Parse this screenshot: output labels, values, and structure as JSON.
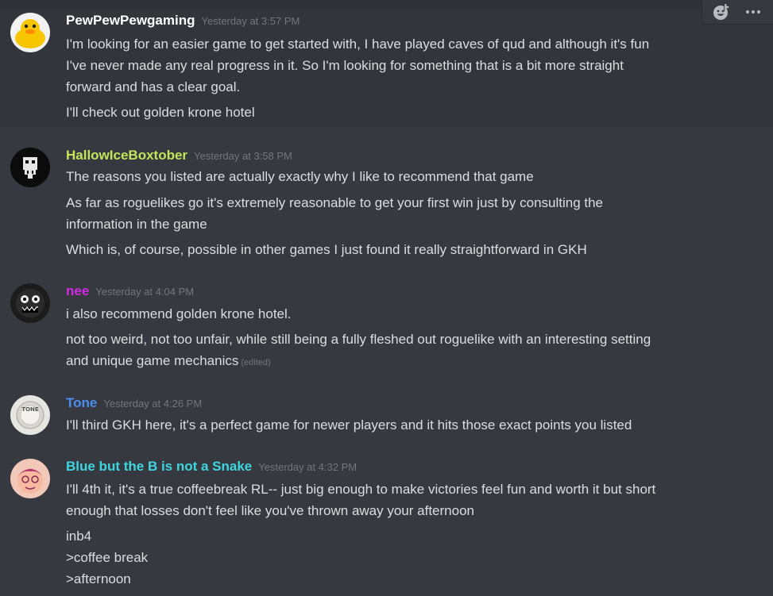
{
  "colors": {
    "background": "#36393f",
    "text": "#dcddde",
    "timestamp": "#72767d",
    "user_pewpew": "#ffffff",
    "user_hallow": "#c6e35a",
    "user_nee": "#d12be3",
    "user_tone": "#4b8df0",
    "user_blue": "#3fd6e0"
  },
  "toolbar": {
    "add_reaction_icon": "add-reaction-icon",
    "more_icon": "more-icon"
  },
  "messages": [
    {
      "username": "PewPewPewgaming",
      "timestamp": "Yesterday at 3:57 PM",
      "lines": [
        "I'm looking for an easier game to get started with, I have played caves of qud and although it's fun",
        "I've never made any real progress in it. So I'm looking for something that is a bit more straight",
        "forward and has a clear goal.",
        "I'll check out golden krone hotel"
      ]
    },
    {
      "username": "HallowIceBoxtober",
      "timestamp": "Yesterday at 3:58 PM",
      "lines": [
        "The reasons you listed are actually exactly why I like to recommend that game",
        "As far as roguelikes go it's extremely reasonable to get your first win just by consulting the",
        "information in the game",
        "Which is, of course, possible in other games I just found it really straightforward in GKH"
      ]
    },
    {
      "username": "nee",
      "timestamp": "Yesterday at 4:04 PM",
      "lines": [
        "i also recommend golden krone hotel.",
        "not too weird, not too unfair, while still being a fully fleshed out roguelike with an interesting setting",
        "and unique game mechanics"
      ],
      "edited": "(edited)"
    },
    {
      "username": "Tone",
      "timestamp": "Yesterday at 4:26 PM",
      "avatar_text": "TONE",
      "lines": [
        "I'll third GKH here, it's a perfect game for newer players and it hits those exact points you listed"
      ]
    },
    {
      "username": "Blue but the B is not a Snake",
      "timestamp": "Yesterday at 4:32 PM",
      "lines": [
        "I'll 4th it, it's a true coffeebreak RL-- just big enough to make victories feel fun and worth it but short",
        "enough that losses don't feel like you've thrown away your afternoon",
        "inb4",
        ">coffee break",
        ">afternoon"
      ]
    }
  ]
}
